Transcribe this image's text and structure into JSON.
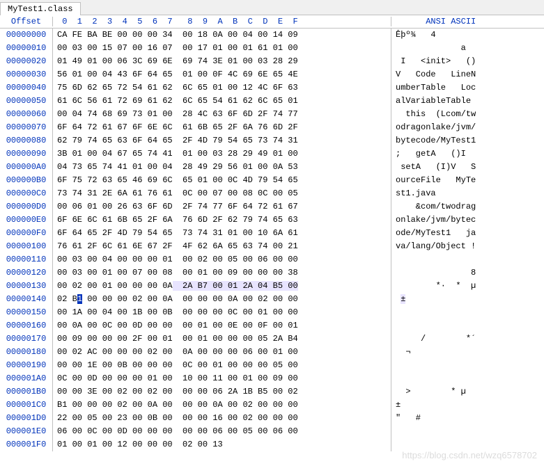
{
  "tab": {
    "label": "MyTest1.class"
  },
  "header": {
    "offset": "Offset",
    "cols": " 0  1  2  3  4  5  6  7   8  9  A  B  C  D  E  F",
    "ascii": "      ANSI ASCII"
  },
  "highlight_row_index": 19,
  "rows": [
    {
      "off": "00000000",
      "hex": "CA FE BA BE 00 00 00 34  00 18 0A 00 04 00 14 09",
      "asc": "Êþº¾   4        "
    },
    {
      "off": "00000010",
      "hex": "00 03 00 15 07 00 16 07  00 17 01 00 01 61 01 00",
      "asc": "             a  "
    },
    {
      "off": "00000020",
      "hex": "01 49 01 00 06 3C 69 6E  69 74 3E 01 00 03 28 29",
      "asc": " I   <init>   ()"
    },
    {
      "off": "00000030",
      "hex": "56 01 00 04 43 6F 64 65  01 00 0F 4C 69 6E 65 4E",
      "asc": "V   Code   LineN"
    },
    {
      "off": "00000040",
      "hex": "75 6D 62 65 72 54 61 62  6C 65 01 00 12 4C 6F 63",
      "asc": "umberTable   Loc"
    },
    {
      "off": "00000050",
      "hex": "61 6C 56 61 72 69 61 62  6C 65 54 61 62 6C 65 01",
      "asc": "alVariableTable "
    },
    {
      "off": "00000060",
      "hex": "00 04 74 68 69 73 01 00  28 4C 63 6F 6D 2F 74 77",
      "asc": "  this  (Lcom/tw"
    },
    {
      "off": "00000070",
      "hex": "6F 64 72 61 67 6F 6E 6C  61 6B 65 2F 6A 76 6D 2F",
      "asc": "odragonlake/jvm/"
    },
    {
      "off": "00000080",
      "hex": "62 79 74 65 63 6F 64 65  2F 4D 79 54 65 73 74 31",
      "asc": "bytecode/MyTest1"
    },
    {
      "off": "00000090",
      "hex": "3B 01 00 04 67 65 74 41  01 00 03 28 29 49 01 00",
      "asc": ";   getA   ()I  "
    },
    {
      "off": "000000A0",
      "hex": "04 73 65 74 41 01 00 04  28 49 29 56 01 00 0A 53",
      "asc": " setA   (I)V   S"
    },
    {
      "off": "000000B0",
      "hex": "6F 75 72 63 65 46 69 6C  65 01 00 0C 4D 79 54 65",
      "asc": "ourceFile   MyTe"
    },
    {
      "off": "000000C0",
      "hex": "73 74 31 2E 6A 61 76 61  0C 00 07 00 08 0C 00 05",
      "asc": "st1.java        "
    },
    {
      "off": "000000D0",
      "hex": "00 06 01 00 26 63 6F 6D  2F 74 77 6F 64 72 61 67",
      "asc": "    &com/twodrag"
    },
    {
      "off": "000000E0",
      "hex": "6F 6E 6C 61 6B 65 2F 6A  76 6D 2F 62 79 74 65 63",
      "asc": "onlake/jvm/bytec"
    },
    {
      "off": "000000F0",
      "hex": "6F 64 65 2F 4D 79 54 65  73 74 31 01 00 10 6A 61",
      "asc": "ode/MyTest1   ja"
    },
    {
      "off": "00000100",
      "hex": "76 61 2F 6C 61 6E 67 2F  4F 62 6A 65 63 74 00 21",
      "asc": "va/lang/Object !"
    },
    {
      "off": "00000110",
      "hex": "00 03 00 04 00 00 00 01  00 02 00 05 00 06 00 00",
      "asc": "                "
    },
    {
      "off": "00000120",
      "hex": "00 03 00 01 00 07 00 08  00 01 00 09 00 00 00 38",
      "asc": "               8"
    },
    {
      "off": "00000130",
      "hex": "00 02 00 01 00 00 00 0A  2A B7 00 01 2A 04 B5 00",
      "asc": "        *·  *  µ "
    },
    {
      "off": "00000140",
      "hex": "02 B1 00 00 00 02 00 0A  00 00 00 0A 00 02 00 00",
      "asc": " ±              "
    },
    {
      "off": "00000150",
      "hex": "00 1A 00 04 00 1B 00 0B  00 00 00 0C 00 01 00 00",
      "asc": "                "
    },
    {
      "off": "00000160",
      "hex": "00 0A 00 0C 00 0D 00 00  00 01 00 0E 00 0F 00 01",
      "asc": "                "
    },
    {
      "off": "00000170",
      "hex": "00 09 00 00 00 2F 00 01  00 01 00 00 00 05 2A B4",
      "asc": "     /        *´"
    },
    {
      "off": "00000180",
      "hex": "00 02 AC 00 00 00 02 00  0A 00 00 00 06 00 01 00",
      "asc": "  ¬             "
    },
    {
      "off": "00000190",
      "hex": "00 00 1E 00 0B 00 00 00  0C 00 01 00 00 00 05 00",
      "asc": "                "
    },
    {
      "off": "000001A0",
      "hex": "0C 00 0D 00 00 00 01 00  10 00 11 00 01 00 09 00",
      "asc": "                "
    },
    {
      "off": "000001B0",
      "hex": "00 00 3E 00 02 00 02 00  00 00 06 2A 1B B5 00 02",
      "asc": "  >        * µ  "
    },
    {
      "off": "000001C0",
      "hex": "B1 00 00 00 02 00 0A 00  00 00 0A 00 02 00 00 00",
      "asc": "±               "
    },
    {
      "off": "000001D0",
      "hex": "22 00 05 00 23 00 0B 00  00 00 16 00 02 00 00 00",
      "asc": "\"   #           "
    },
    {
      "off": "000001E0",
      "hex": "06 00 0C 00 0D 00 00 00  00 00 06 00 05 00 06 00",
      "asc": "                "
    },
    {
      "off": "000001F0",
      "hex": "01 00 01 00 12 00 00 00  02 00 13",
      "asc": "           "
    }
  ],
  "caret": {
    "row_index": 20,
    "byte_index": 1
  },
  "watermark": "https://blog.csdn.net/wzq6578702"
}
